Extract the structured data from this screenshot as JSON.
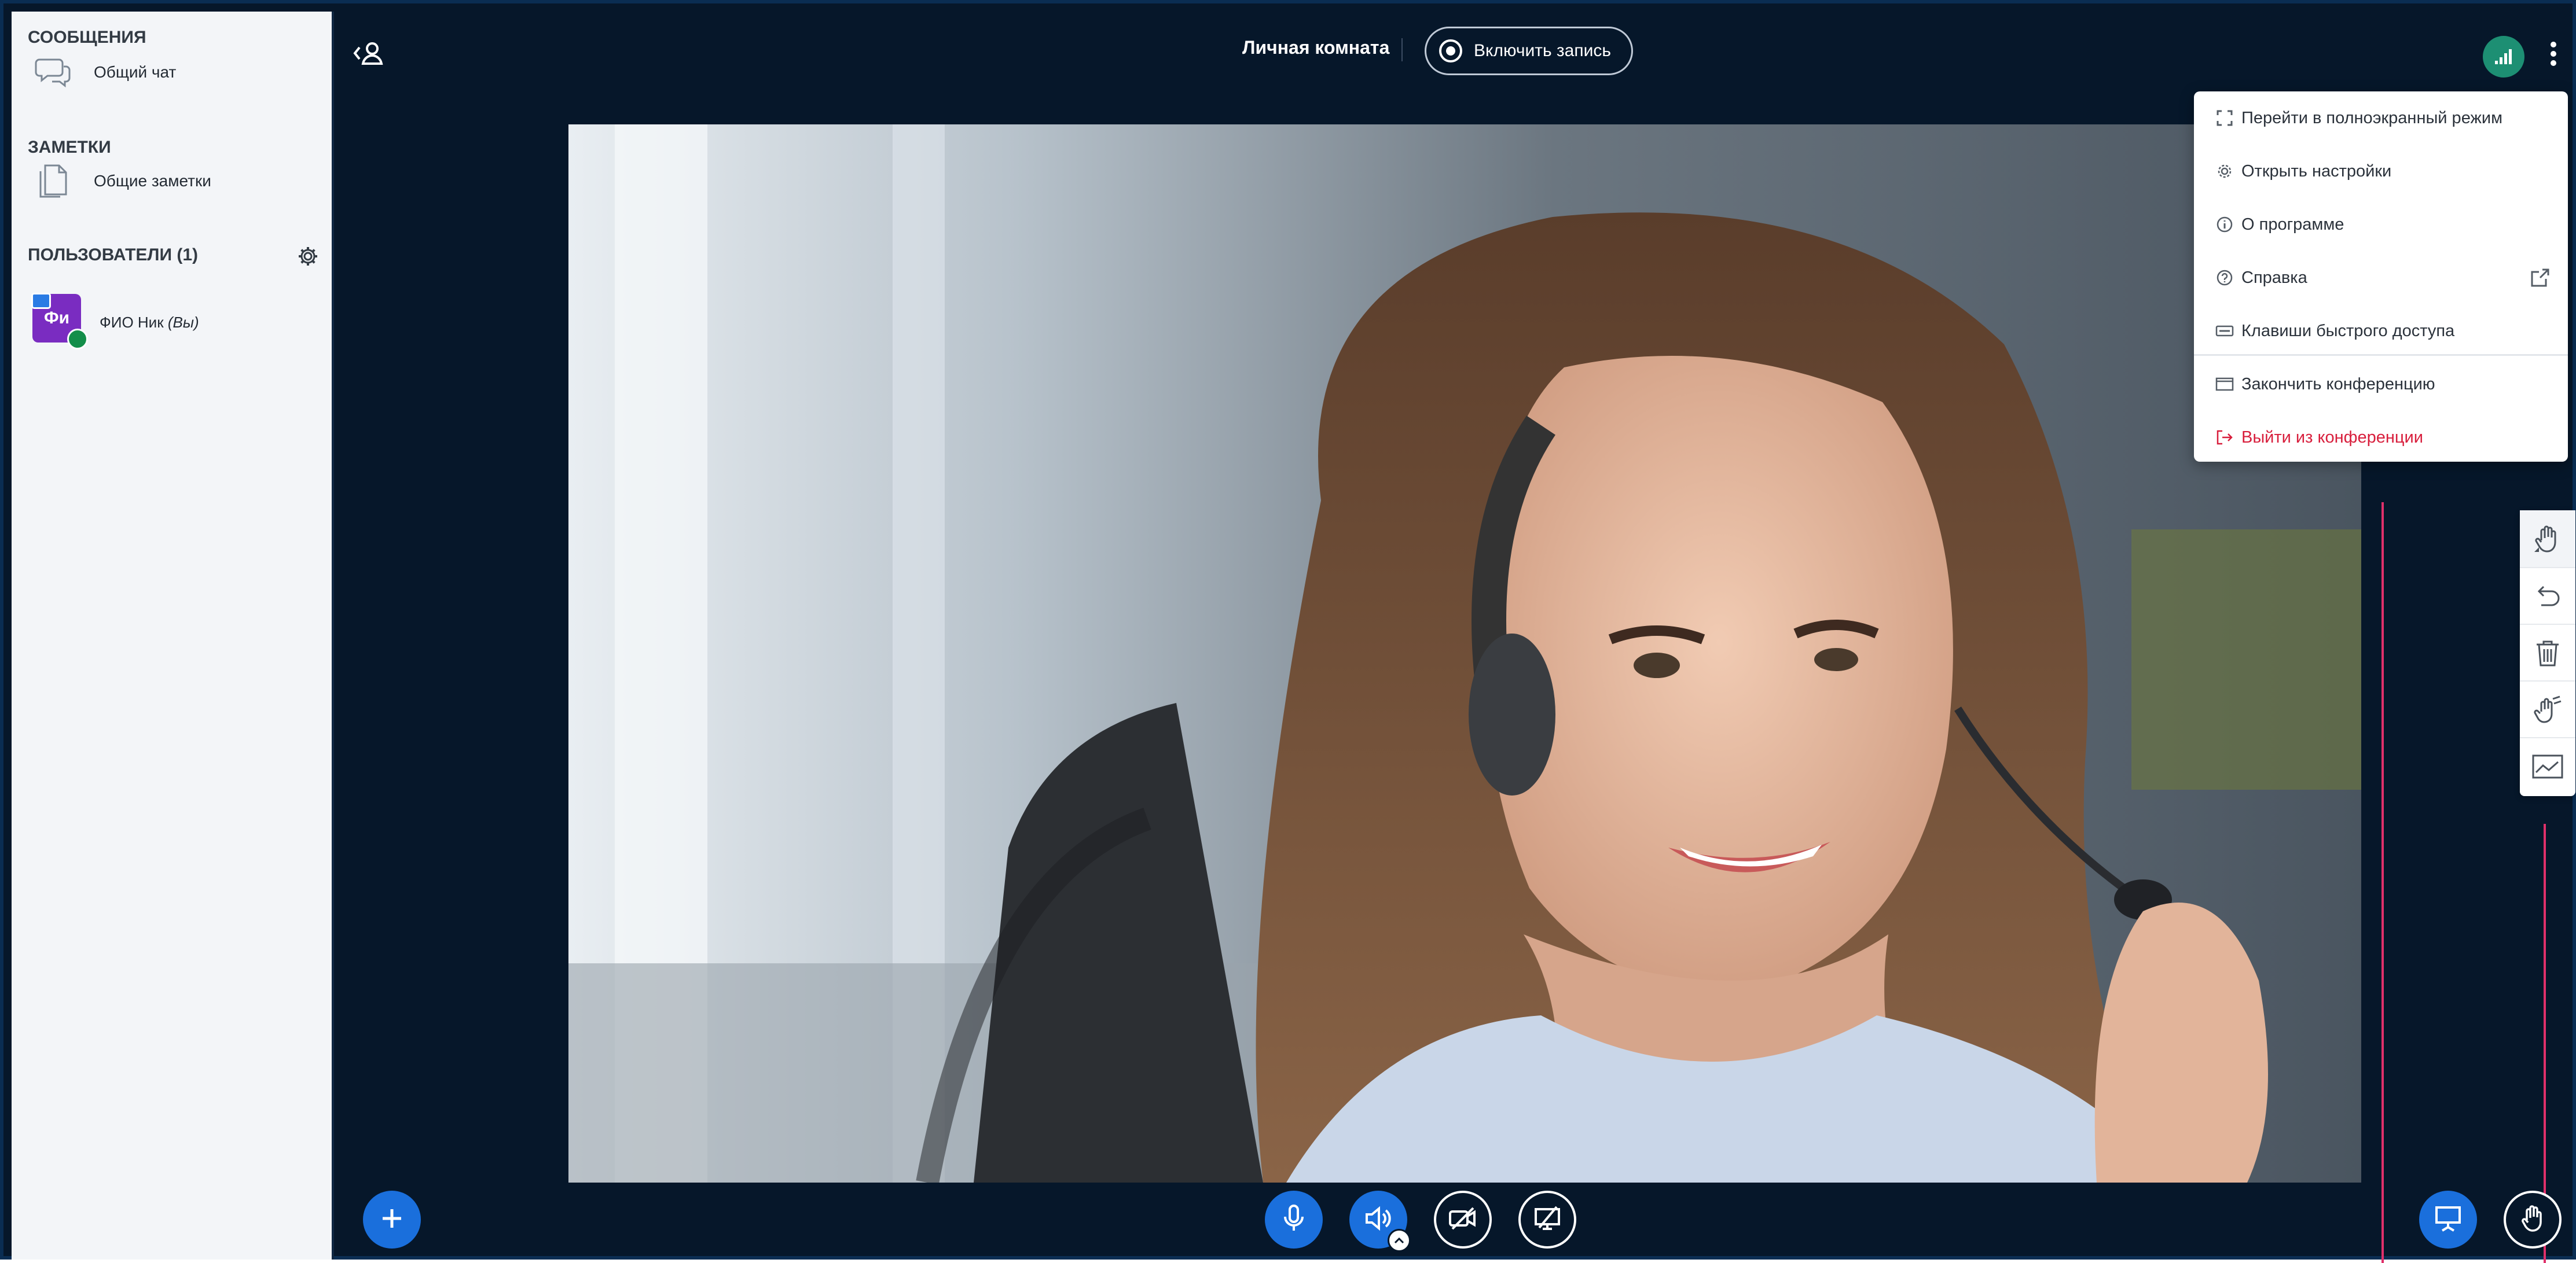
{
  "sidebar": {
    "messages_title": "СООБЩЕНИЯ",
    "public_chat_label": "Общий чат",
    "notes_title": "ЗАМЕТКИ",
    "shared_notes_label": "Общие заметки",
    "users_title": "ПОЛЬЗОВАТЕЛИ (1)",
    "users": [
      {
        "initials": "Фи",
        "name": "ФИО Ник",
        "you_tag": "(Вы)"
      }
    ]
  },
  "topbar": {
    "room_name": "Личная комната",
    "record_label": "Включить запись"
  },
  "options_menu": {
    "items": [
      {
        "label": "Перейти в полноэкранный режим",
        "icon": "fullscreen-icon"
      },
      {
        "label": "Открыть настройки",
        "icon": "gear-icon"
      },
      {
        "label": "О программе",
        "icon": "info-icon"
      },
      {
        "label": "Справка",
        "icon": "help-icon"
      },
      {
        "label": "Клавиши быстрого доступа",
        "icon": "keyboard-icon"
      },
      {
        "label": "Закончить конференцию",
        "icon": "end-meeting-icon"
      },
      {
        "label": "Выйти из конференции",
        "icon": "logout-icon"
      }
    ]
  },
  "whiteboard_tools": [
    "hand-icon",
    "undo-icon",
    "trash-icon",
    "multi-user-icon",
    "chart-icon"
  ],
  "bottom_controls": [
    "plus-icon",
    "microphone-icon",
    "speaker-icon",
    "camera-off-icon",
    "screen-share-off-icon",
    "presentation-icon",
    "raise-hand-icon"
  ],
  "colors": {
    "background": "#06172a",
    "accent_blue": "#1a6fdc",
    "danger": "#d81e3c",
    "connection_green": "#1d8f73",
    "annotation_pink": "#e0306a"
  }
}
